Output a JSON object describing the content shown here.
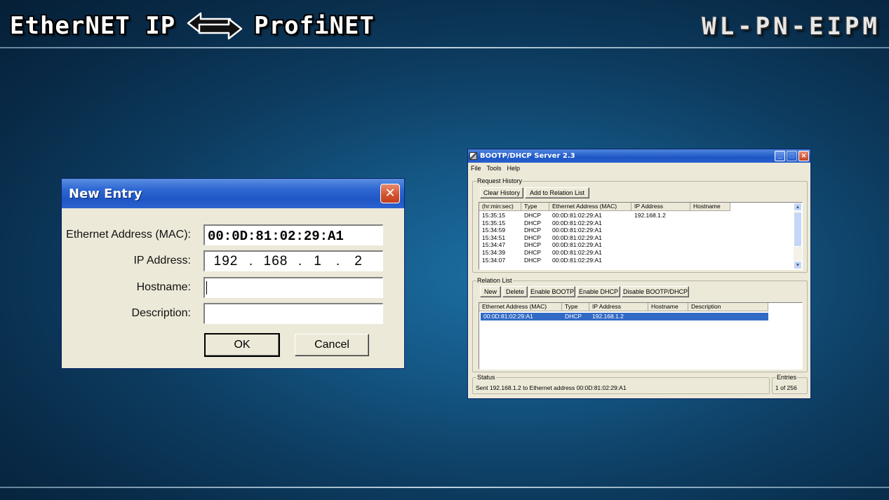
{
  "slide": {
    "title_left": "EtherNET IP",
    "title_right": "ProfiNET",
    "product_code": "WL-PN-EIPM"
  },
  "new_entry_dialog": {
    "title": "New Entry",
    "close_glyph": "✕",
    "fields": {
      "mac_label": "Ethernet Address (MAC):",
      "mac_value": "00:0D:81:02:29:A1",
      "ip_label": "IP Address:",
      "ip_octets": [
        "192",
        "168",
        "1",
        "2"
      ],
      "ip_dot": ".",
      "hostname_label": "Hostname:",
      "hostname_value": "",
      "description_label": "Description:",
      "description_value": ""
    },
    "ok_label": "OK",
    "cancel_label": "Cancel"
  },
  "bootp_window": {
    "title": "BOOTP/DHCP Server 2.3",
    "menu": [
      "File",
      "Tools",
      "Help"
    ],
    "request_history": {
      "label": "Request History",
      "buttons": {
        "clear": "Clear History",
        "add": "Add to Relation List"
      },
      "columns": [
        "(hr:min:sec)",
        "Type",
        "Ethernet Address (MAC)",
        "IP Address",
        "Hostname"
      ],
      "rows": [
        [
          "15:35:15",
          "DHCP",
          "00:0D:81:02:29:A1",
          "192.168.1.2",
          ""
        ],
        [
          "15:35:15",
          "DHCP",
          "00:0D:81:02:29:A1",
          "",
          ""
        ],
        [
          "15:34:59",
          "DHCP",
          "00:0D:81:02:29:A1",
          "",
          ""
        ],
        [
          "15:34:51",
          "DHCP",
          "00:0D:81:02:29:A1",
          "",
          ""
        ],
        [
          "15:34:47",
          "DHCP",
          "00:0D:81:02:29:A1",
          "",
          ""
        ],
        [
          "15:34:39",
          "DHCP",
          "00:0D:81:02:29:A1",
          "",
          ""
        ],
        [
          "15:34:07",
          "DHCP",
          "00:0D:81:02:29:A1",
          "",
          ""
        ]
      ]
    },
    "relation_list": {
      "label": "Relation List",
      "buttons": {
        "new": "New",
        "delete": "Delete",
        "enable_bootp": "Enable BOOTP",
        "enable_dhcp": "Enable DHCP",
        "disable": "Disable BOOTP/DHCP"
      },
      "columns": [
        "Ethernet Address (MAC)",
        "Type",
        "IP Address",
        "Hostname",
        "Description"
      ],
      "rows": [
        [
          "00:0D:81:02:29:A1",
          "DHCP",
          "192.168.1.2",
          "",
          ""
        ]
      ]
    },
    "status": {
      "label": "Status",
      "text": "Sent 192.168.1.2 to Ethernet address 00:0D:81:02:29:A1"
    },
    "entries": {
      "label": "Entries",
      "text": "1 of 256"
    }
  },
  "colors": {
    "xp_titlebar": "#2f68d3",
    "xp_face": "#ece9d8",
    "selection": "#316ac5",
    "background_center": "#1c6fa4"
  }
}
